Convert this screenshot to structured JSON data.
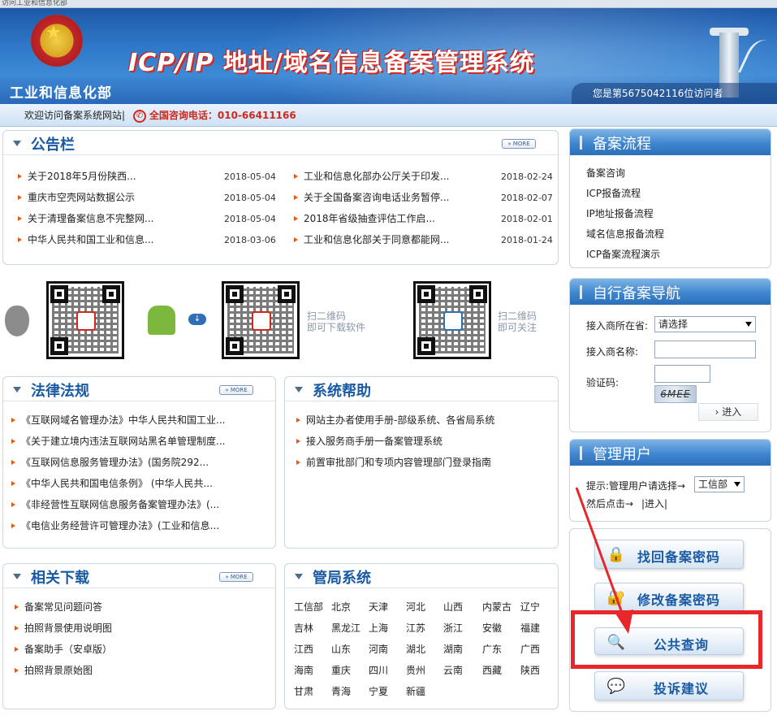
{
  "browser": {
    "tab_text": "访问工业和信息化部"
  },
  "header": {
    "ministry": "工业和信息化部",
    "title_latin": "ICP/IP",
    "title_cn": "地址/域名信息备案管理系统",
    "visitor_text": "您是第5675042116位访问者"
  },
  "infobar": {
    "welcome": "欢迎访问备案系统网站",
    "separator": "|",
    "hotline_label": "全国咨询电话：",
    "hotline_number": "010-66411166"
  },
  "more_label": "MORE",
  "notice": {
    "title": "公告栏",
    "left": [
      {
        "text": "关于2018年5月份陕西...",
        "date": "2018-05-04"
      },
      {
        "text": "重庆市空壳网站数据公示",
        "date": "2018-05-04"
      },
      {
        "text": "关于清理备案信息不完整网...",
        "date": "2018-05-04"
      },
      {
        "text": "中华人民共和国工业和信息...",
        "date": "2018-03-06"
      }
    ],
    "right": [
      {
        "text": "工业和信息化部办公厅关于印发...",
        "date": "2018-02-24"
      },
      {
        "text": "关于全国备案咨询电话业务暂停...",
        "date": "2018-02-07"
      },
      {
        "text": "2018年省级抽查评估工作启...",
        "date": "2018-02-01"
      },
      {
        "text": "工业和信息化部关于同意都能网...",
        "date": "2018-01-24"
      }
    ]
  },
  "qr": {
    "download_caption_1": "扫二维码",
    "download_caption_2": "即可下载软件",
    "follow_caption_1": "扫二维码",
    "follow_caption_2": "即可关注"
  },
  "law": {
    "title": "法律法规",
    "items": [
      "《互联网域名管理办法》中华人民共和国工业...",
      "《关于建立境内违法互联网站黑名单管理制度...",
      "《互联网信息服务管理办法》(国务院292...",
      "《中华人民共和国电信条例》 (中华人民共...",
      "《非经营性互联网信息服务备案管理办法》(...",
      "《电信业务经营许可管理办法》(工业和信息..."
    ]
  },
  "help": {
    "title": "系统帮助",
    "items": [
      "网站主办者使用手册-部级系统、各省局系统",
      "接入服务商手册一备案管理系统",
      "前置审批部门和专项内容管理部门登录指南"
    ]
  },
  "downloads": {
    "title": "相关下载",
    "items": [
      "备案常见问题问答",
      "拍照背景使用说明图",
      "备案助手（安卓版）",
      "拍照背景原始图"
    ]
  },
  "bureau": {
    "title": "管局系统",
    "rows": [
      [
        "工信部",
        "北京",
        "天津",
        "河北",
        "山西",
        "内蒙古",
        "辽宁"
      ],
      [
        "吉林",
        "黑龙江",
        "上海",
        "江苏",
        "浙江",
        "安徽",
        "福建"
      ],
      [
        "江西",
        "山东",
        "河南",
        "湖北",
        "湖南",
        "广东",
        "广西"
      ],
      [
        "海南",
        "重庆",
        "四川",
        "贵州",
        "云南",
        "西藏",
        "陕西"
      ],
      [
        "甘肃",
        "青海",
        "宁夏",
        "新疆"
      ]
    ]
  },
  "flow": {
    "title": "备案流程",
    "items": [
      "备案咨询",
      "ICP报备流程",
      "IP地址报备流程",
      "域名信息报备流程",
      "ICP备案流程演示"
    ]
  },
  "nav": {
    "title": "自行备案导航",
    "location_label": "接入商所在省:",
    "location_value": "请选择",
    "name_label": "接入商名称:",
    "captcha_label": "验证码:",
    "captcha_text": "6MEE",
    "enter_label": "进入"
  },
  "admin": {
    "title": "管理用户",
    "hint": "提示:管理用户请选择→",
    "select_value": "工信部",
    "then": "然后点击→",
    "enter_link": "|进入|"
  },
  "actions": {
    "recover": "找回备案密码",
    "modify": "修改备案密码",
    "query": "公共查询",
    "complaint": "投诉建议"
  },
  "colors": {
    "accent": "#1a5aa5",
    "hotline": "#d2271c",
    "highlight": "#e8272a"
  }
}
